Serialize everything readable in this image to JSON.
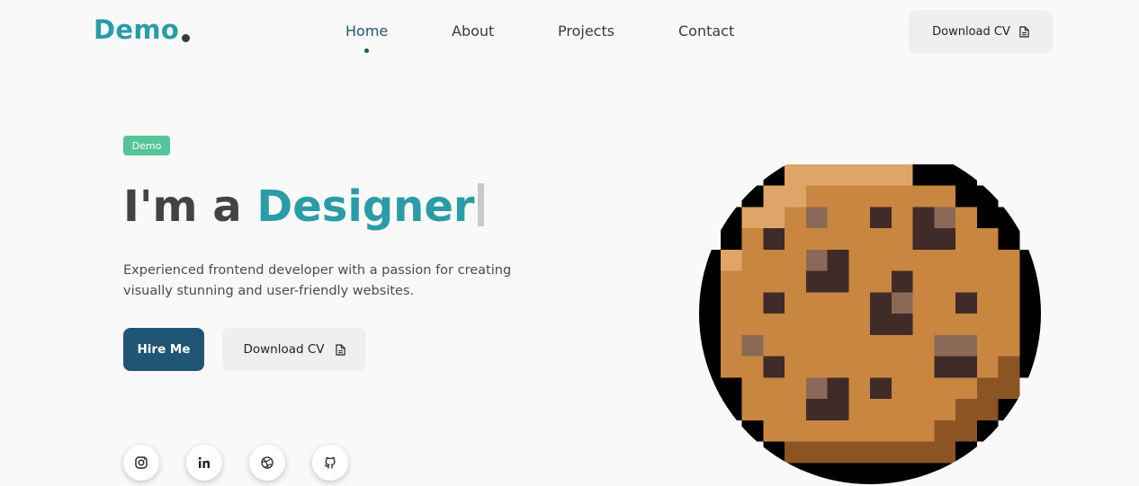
{
  "header": {
    "logo_text": "Demo",
    "nav": [
      {
        "label": "Home",
        "active": true
      },
      {
        "label": "About",
        "active": false
      },
      {
        "label": "Projects",
        "active": false
      },
      {
        "label": "Contact",
        "active": false
      }
    ],
    "download_cv_label": "Download CV"
  },
  "hero": {
    "badge": "Demo",
    "headline_prefix": "I'm a",
    "headline_role": "Designer",
    "description": "Experienced frontend developer with a passion for creating visually stunning and user-friendly websites.",
    "hire_label": "Hire Me",
    "download_cv_label": "Download CV"
  },
  "social": [
    {
      "name": "instagram-icon"
    },
    {
      "name": "linkedin-icon"
    },
    {
      "name": "dribbble-icon"
    },
    {
      "name": "github-icon"
    }
  ],
  "colors": {
    "accent": "#2a9ca8",
    "primary": "#205573",
    "badge": "#56c59a",
    "background": "#f9f9f9",
    "button_light": "#efefef"
  },
  "hero_image": {
    "name": "pixel-cookie",
    "palette": {
      "K": "#000000",
      "L": "#dea566",
      "B": "#c88641",
      "D": "#3f2b27",
      "M": "#8c6957",
      "R": "#8a5423",
      "F": "#f9f9f9"
    },
    "rows": [
      "FFFFFFFFFFFFFFFF",
      "FFFKLLLLLLKKKFFF",
      "FFKLLBBBBBBBKKFF",
      "FKLLBMBBDBDMBKKF",
      "FKBDBBBBBBDDBBKF",
      "KLBBBMDBBBBBBBBK",
      "KBBBBDDBBDBBBBBK",
      "KBBDBBBBDMBBDBBK",
      "KBBBBBBBDDBBBBBK",
      "KBMBBBBBBBBMMBBK",
      "KBBDBBBBBBBDDBRK",
      "KKBBBMDBDBBBBRRF",
      "FKBBBDDBBBBBRRKF",
      "FFKBBBBBBBBRRKFF",
      "FFFKRRRRRRRRKFFF",
      "FFFFKKKKKKKKFFFF"
    ]
  }
}
